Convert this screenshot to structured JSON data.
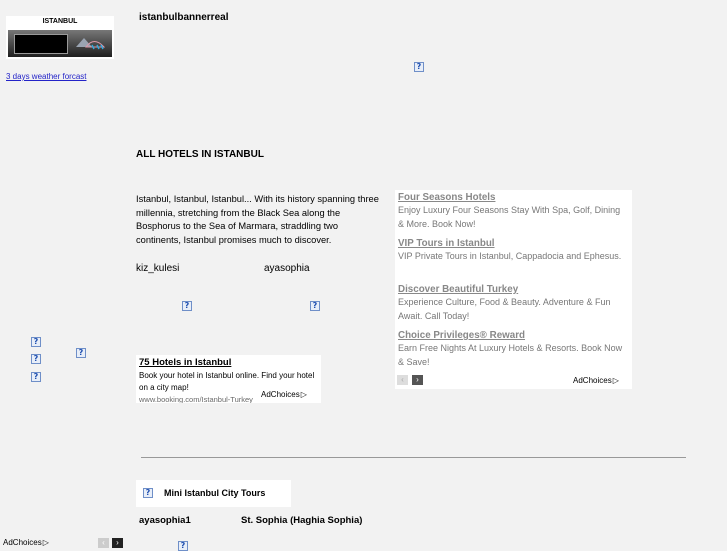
{
  "weather": {
    "widget_title": "ISTANBUL",
    "link": "3 days weather forcast"
  },
  "banner": {
    "alt_text": "istanbulbannerreal"
  },
  "hotels": {
    "heading": "ALL HOTELS IN ISTANBUL",
    "intro": "Istanbul, Istanbul, Istanbul... With its history spanning three millennia, stretching from the Black Sea along the Bosphorus to the Sea of Marmara, straddling two continents, Istanbul promises much to discover.",
    "landmark_left": "kiz_kulesi",
    "landmark_right": "ayasophia"
  },
  "ad_small": {
    "title": "75 Hotels in Istanbul",
    "body": "Book your hotel in Istanbul online. Find your hotel on a city map!",
    "url": "www.booking.com/Istanbul-Turkey",
    "adchoices": "AdChoices"
  },
  "ad_large": {
    "items": [
      {
        "title": "Four Seasons Hotels",
        "text": "Enjoy Luxury Four Seasons Stay With Spa, Golf, Dining & More. Book Now!"
      },
      {
        "title": "VIP Tours in Istanbul",
        "text": "VIP Private Tours in Istanbul, Cappadocia and Ephesus."
      },
      {
        "title": "Discover Beautiful Turkey",
        "text": "Experience Culture, Food & Beauty. Adventure & Fun Await. Call Today!"
      },
      {
        "title": "Choice Privileges® Reward",
        "text": "Earn Free Nights At Luxury Hotels & Resorts. Book Now & Save!"
      }
    ],
    "prev_glyph": "‹",
    "next_glyph": "›",
    "adchoices": "AdChoices"
  },
  "tours": {
    "title": "Mini Istanbul City Tours",
    "row_name": "ayasophia1",
    "row_desc": "St. Sophia (Haghia Sophia)"
  },
  "footer": {
    "adchoices": "AdChoices"
  },
  "icons": {
    "broken_image": "?",
    "adchoices_triangle": "▷"
  },
  "colors": {
    "background": "#f2f2f2",
    "link": "#2323c8"
  }
}
